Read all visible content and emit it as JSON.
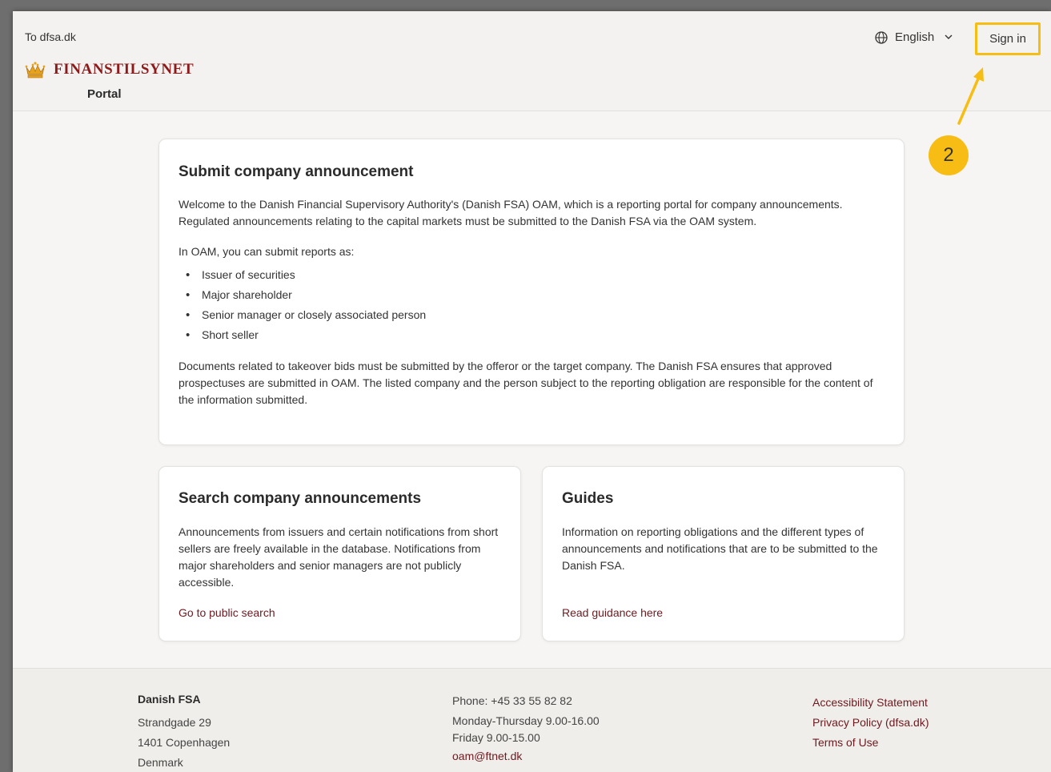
{
  "header": {
    "back_link": "To dfsa.dk",
    "brand": "FINANSTILSYNET",
    "subtitle": "Portal",
    "language": "English",
    "sign_in": "Sign in"
  },
  "annotation": {
    "badge": "2",
    "color": "#f6be14"
  },
  "cards": {
    "submit": {
      "title": "Submit company announcement",
      "intro": "Welcome to the Danish Financial Supervisory Authority's (Danish FSA) OAM, which is a reporting portal for company announcements. Regulated announcements relating to the capital markets must be submitted to the Danish FSA via the OAM system.",
      "list_intro": "In OAM, you can submit reports as:",
      "items": [
        "Issuer of securities",
        "Major shareholder",
        "Senior manager or closely associated person",
        "Short seller"
      ],
      "outro": "Documents related to takeover bids must be submitted by the offeror or the target company. The Danish FSA ensures that approved prospectuses are submitted in OAM. The listed company and the person subject to the reporting obligation are responsible for the content of the information submitted."
    },
    "search": {
      "title": "Search company announcements",
      "body": "Announcements from issuers and certain notifications from short sellers are freely available in the database. Notifications from major shareholders and senior managers are not publicly accessible.",
      "link": "Go to public search"
    },
    "guides": {
      "title": "Guides",
      "body": "Information on reporting obligations and the different types of announcements and notifications that are to be submitted to the Danish FSA.",
      "link": "Read guidance here"
    }
  },
  "footer": {
    "org": "Danish FSA",
    "address": [
      "Strandgade 29",
      "1401 Copenhagen",
      "Denmark"
    ],
    "phone": "Phone: +45 33 55 82 82",
    "hours_1": "Monday-Thursday 9.00-16.00",
    "hours_2": "Friday 9.00-15.00",
    "email": "oam@ftnet.dk",
    "links": [
      "Accessibility Statement",
      "Privacy Policy (dfsa.dk)",
      "Terms of Use"
    ]
  },
  "colors": {
    "brand": "#8c1a1a",
    "link": "#6e1a20",
    "highlight": "#f6be14"
  },
  "icons": [
    "globe-icon",
    "chevron-down-icon",
    "crown-logo-icon"
  ]
}
